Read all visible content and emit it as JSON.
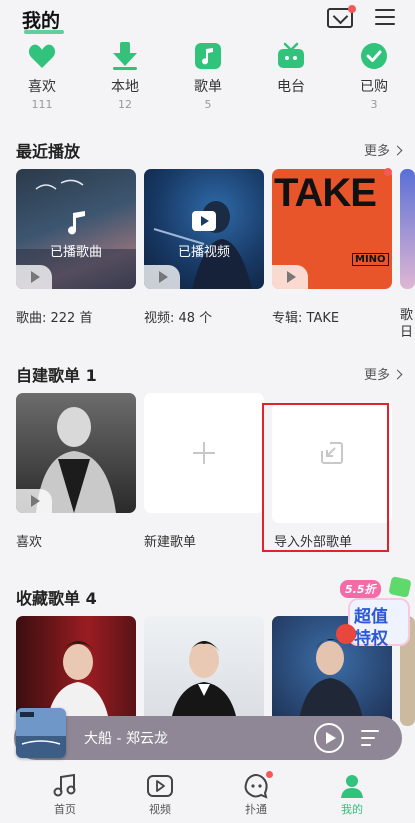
{
  "header": {
    "title": "我的"
  },
  "colors": {
    "accent": "#31c27c",
    "badge": "#f25a5a",
    "highlight_box": "#e0222a"
  },
  "quick_items": [
    {
      "icon": "heart-icon",
      "label": "喜欢",
      "count": "111"
    },
    {
      "icon": "download-icon",
      "label": "本地",
      "count": "12"
    },
    {
      "icon": "music-note-icon",
      "label": "歌单",
      "count": "5"
    },
    {
      "icon": "tv-icon",
      "label": "电台",
      "count": ""
    },
    {
      "icon": "check-icon",
      "label": "已购",
      "count": "3"
    }
  ],
  "recent": {
    "title": "最近播放",
    "more": "更多",
    "cards": [
      {
        "overlay": "已播歌曲",
        "label": "歌曲: 222 首"
      },
      {
        "overlay": "已播视频",
        "label": "视频: 48 个"
      },
      {
        "overlay": "",
        "cover_text": "TAKE",
        "cover_sub": "MINO",
        "label": "专辑: TAKE"
      },
      {
        "overlay": "",
        "label": "歌\n日"
      }
    ]
  },
  "created": {
    "title": "自建歌单 1",
    "more": "更多",
    "cards": [
      {
        "label": "喜欢"
      },
      {
        "label": "新建歌单"
      },
      {
        "label": "导入外部歌单"
      }
    ]
  },
  "favorites": {
    "title": "收藏歌单 4",
    "promo_tag": "5.5折",
    "promo_text": [
      "超值",
      "特权"
    ]
  },
  "player": {
    "title": "大船 - 郑云龙"
  },
  "bottom_nav": [
    {
      "icon": "music-note-icon",
      "label": "首页"
    },
    {
      "icon": "video-icon",
      "label": "视频"
    },
    {
      "icon": "chat-icon",
      "label": "扑通"
    },
    {
      "icon": "person-icon",
      "label": "我的"
    }
  ]
}
